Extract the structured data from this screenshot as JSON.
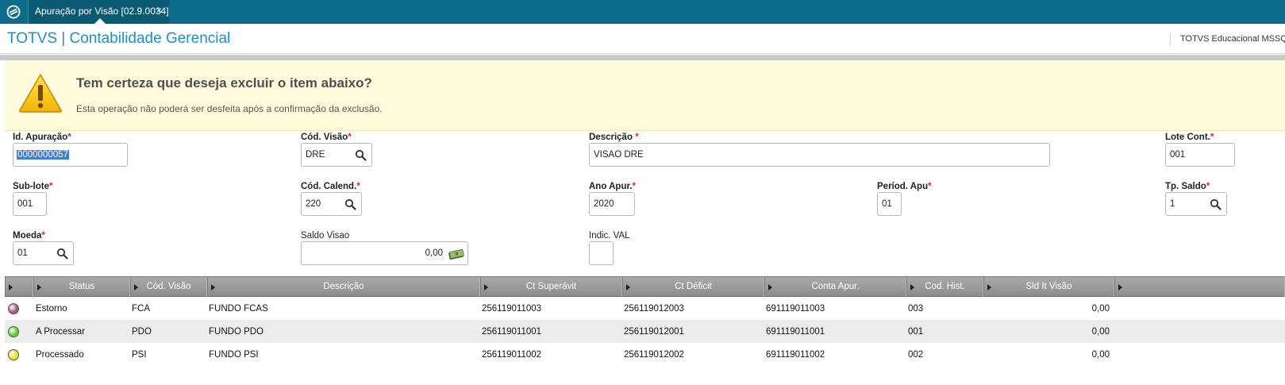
{
  "tab": {
    "label": "Apuração por Visão [02.9.0034]",
    "close": "×"
  },
  "header": {
    "title": "TOTVS | Contabilidade Gerencial",
    "environment": "TOTVS Educacional MSSQL"
  },
  "warning": {
    "title": "Tem certeza que deseja excluir o item abaixo?",
    "message": "Esta operação não poderá ser desfeita após a confirmação da exclusão."
  },
  "form": {
    "required_mark": "*",
    "id_apuracao": {
      "label": "Id. Apuração",
      "value": "0000000057"
    },
    "cod_visao": {
      "label": "Cód. Visão",
      "value": "DRE"
    },
    "descricao": {
      "label": "Descrição ",
      "value": "VISAO DRE"
    },
    "lote_cont": {
      "label": "Lote Cont.",
      "value": "001"
    },
    "sub_lote": {
      "label": "Sub-lote",
      "value": "001"
    },
    "cod_calend": {
      "label": "Cód. Calend.",
      "value": "220"
    },
    "ano_apur": {
      "label": "Ano Apur.",
      "value": "2020"
    },
    "periodo_apu": {
      "label": "Períod.  Apu",
      "value": "01"
    },
    "tp_saldo": {
      "label": "Tp. Saldo",
      "value": "1"
    },
    "moeda": {
      "label": "Moeda",
      "value": "01"
    },
    "saldo_visao": {
      "label": "Saldo Visao",
      "value": "0,00"
    },
    "indic_val": {
      "label": "Indic. VAL",
      "value": ""
    }
  },
  "grid": {
    "columns": [
      "Status",
      "Cód. Visão",
      "Descrição",
      "Ct Superávit",
      "Ct Déficit",
      "Conta Apur.",
      "Cod. Hist.",
      "Sld It Visão"
    ],
    "rows": [
      {
        "status_color": "#a0587e",
        "status": "Estorno",
        "cod_visao": "FCA",
        "descricao": "FUNDO FCAS",
        "ct_superavit": "256119011003",
        "ct_deficit": "256119012003",
        "conta_apur": "691119011003",
        "cod_hist": "003",
        "sld": "0,00"
      },
      {
        "status_color": "#5fd22b",
        "status": "A Processar",
        "cod_visao": "PDO",
        "descricao": "FUNDO PDO",
        "ct_superavit": "256119011001",
        "ct_deficit": "256119012001",
        "conta_apur": "691119011001",
        "cod_hist": "001",
        "sld": "0,00"
      },
      {
        "status_color": "#e8e22a",
        "status": "Processado",
        "cod_visao": "PSI",
        "descricao": "FUNDO PSI",
        "ct_superavit": "256119011002",
        "ct_deficit": "256119012002",
        "conta_apur": "691119011002",
        "cod_hist": "002",
        "sld": "0,00"
      }
    ]
  }
}
